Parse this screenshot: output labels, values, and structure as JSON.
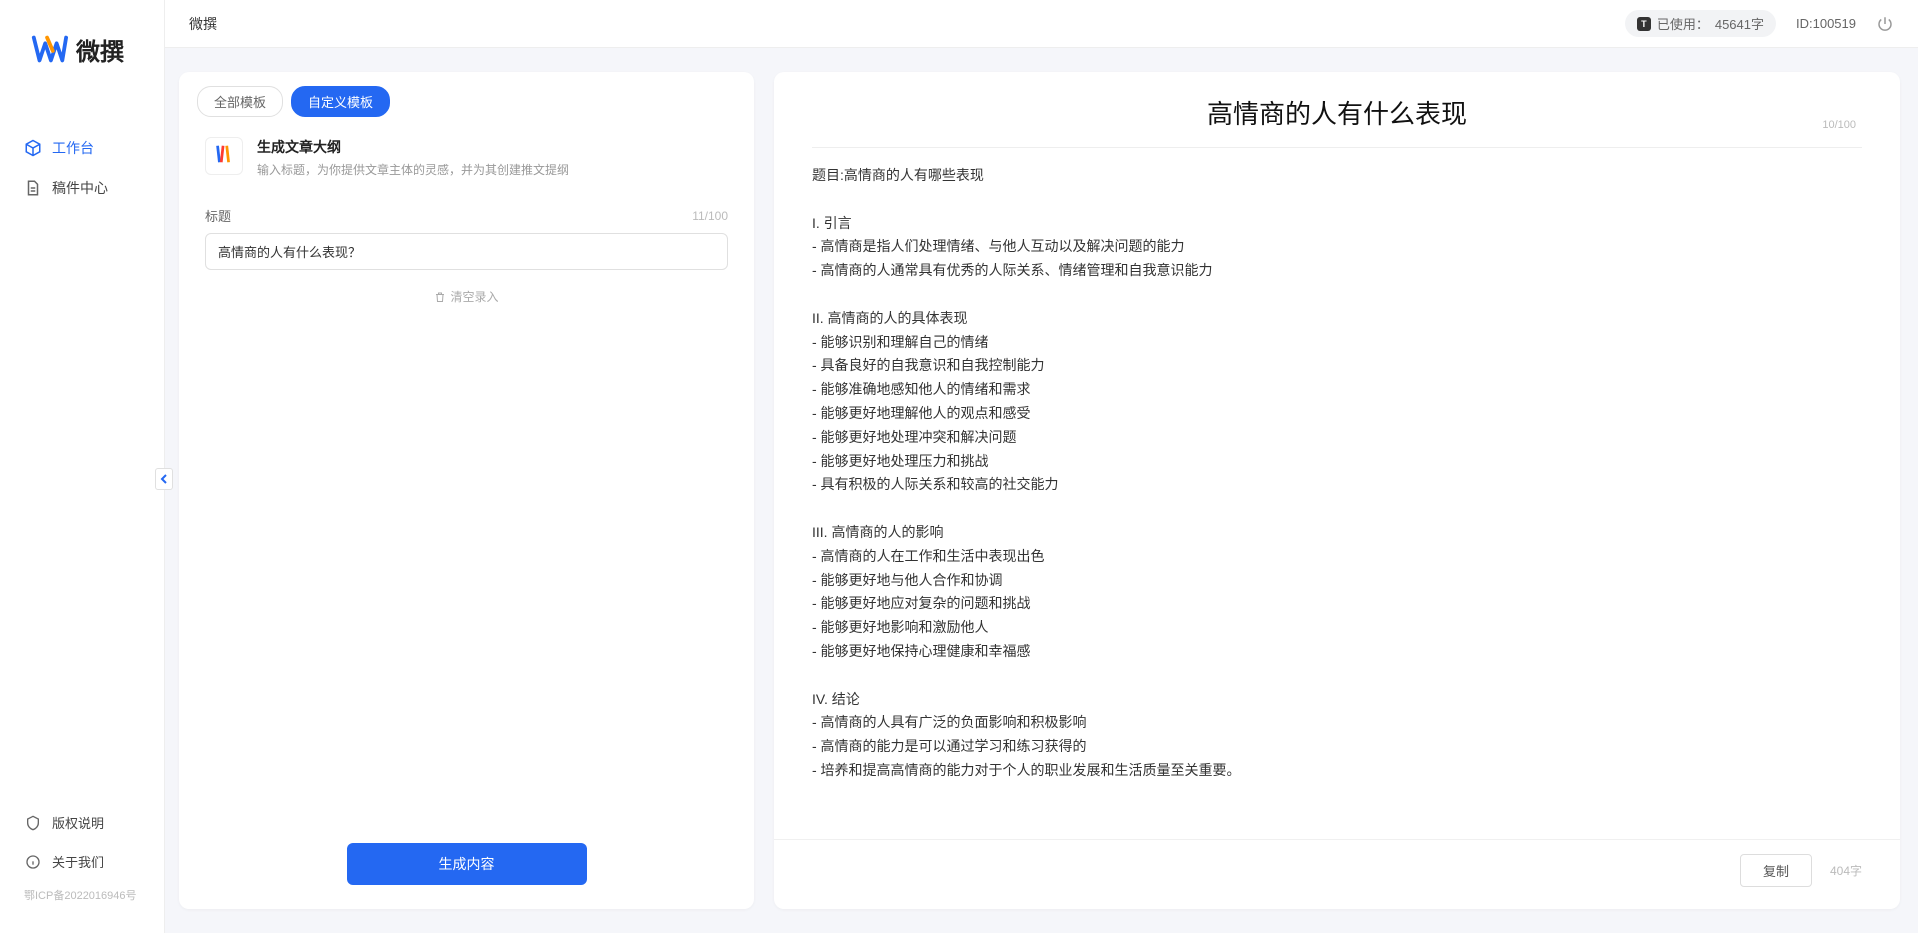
{
  "app_name": "微撰",
  "topbar": {
    "title": "微撰",
    "usage_label": "已使用：",
    "usage_value": "45641字",
    "id_label": "ID:100519"
  },
  "sidebar": {
    "nav": [
      {
        "label": "工作台",
        "icon": "cube",
        "active": true
      },
      {
        "label": "稿件中心",
        "icon": "doc",
        "active": false
      }
    ],
    "bottom": [
      {
        "label": "版权说明",
        "icon": "shield"
      },
      {
        "label": "关于我们",
        "icon": "info"
      }
    ],
    "icp": "鄂ICP备2022016946号"
  },
  "left_panel": {
    "tabs": [
      {
        "label": "全部模板",
        "active": false
      },
      {
        "label": "自定义模板",
        "active": true
      }
    ],
    "template": {
      "title": "生成文章大纲",
      "desc": "输入标题，为你提供文章主体的灵感，并为其创建推文提纲"
    },
    "form": {
      "label": "标题",
      "counter": "11/100",
      "value": "高情商的人有什么表现？",
      "clear": "清空录入"
    },
    "generate": "生成内容"
  },
  "right_panel": {
    "title": "高情商的人有什么表现",
    "title_counter": "10/100",
    "body": "题目:高情商的人有哪些表现\n\nI. 引言\n- 高情商是指人们处理情绪、与他人互动以及解决问题的能力\n- 高情商的人通常具有优秀的人际关系、情绪管理和自我意识能力\n\nII. 高情商的人的具体表现\n- 能够识别和理解自己的情绪\n- 具备良好的自我意识和自我控制能力\n- 能够准确地感知他人的情绪和需求\n- 能够更好地理解他人的观点和感受\n- 能够更好地处理冲突和解决问题\n- 能够更好地处理压力和挑战\n- 具有积极的人际关系和较高的社交能力\n\nIII. 高情商的人的影响\n- 高情商的人在工作和生活中表现出色\n- 能够更好地与他人合作和协调\n- 能够更好地应对复杂的问题和挑战\n- 能够更好地影响和激励他人\n- 能够更好地保持心理健康和幸福感\n\nIV. 结论\n- 高情商的人具有广泛的负面影响和积极影响\n- 高情商的能力是可以通过学习和练习获得的\n- 培养和提高高情商的能力对于个人的职业发展和生活质量至关重要。",
    "copy": "复制",
    "count": "404字"
  }
}
